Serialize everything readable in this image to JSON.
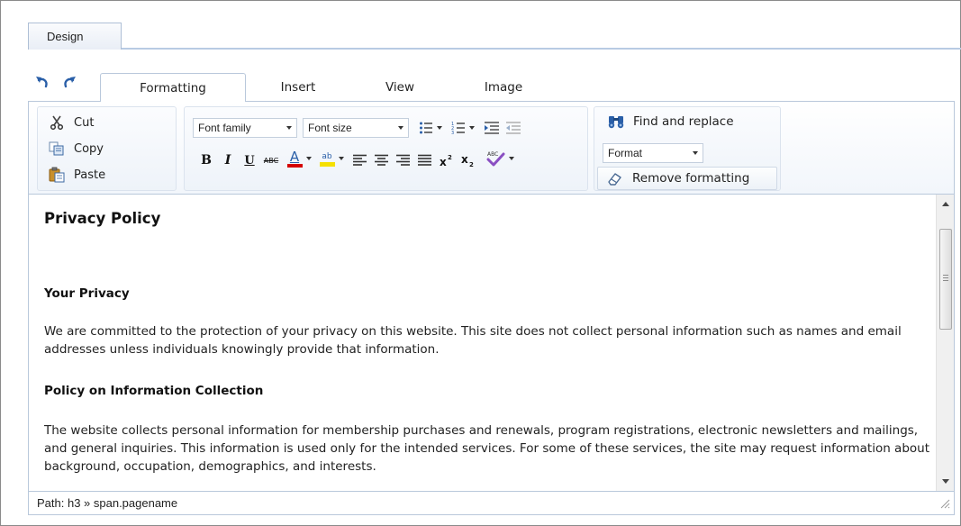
{
  "top_tabs": [
    {
      "label": "Design",
      "active": true
    }
  ],
  "ribbon_tabs": [
    {
      "label": "Formatting",
      "active": true
    },
    {
      "label": "Insert",
      "active": false
    },
    {
      "label": "View",
      "active": false
    },
    {
      "label": "Image",
      "active": false
    }
  ],
  "toolbar": {
    "undo_icon": "undo-icon",
    "redo_icon": "redo-icon",
    "clipboard": {
      "cut_label": "Cut",
      "copy_label": "Copy",
      "paste_label": "Paste"
    },
    "font": {
      "font_family_value": "Font family",
      "font_size_value": "Font size",
      "bold_label": "B",
      "italic_label": "I",
      "underline_label": "U",
      "strikethrough_label": "ABC",
      "font_color_label": "A",
      "highlight_label": "ab",
      "font_color_hex": "#d40000",
      "highlight_hex": "#f5e000"
    },
    "editing": {
      "find_replace_label": "Find and replace",
      "format_value": "Format",
      "remove_formatting_label": "Remove formatting"
    }
  },
  "document": {
    "title": "Privacy Policy",
    "sections": [
      {
        "heading": "Your Privacy",
        "body": "We are committed to the protection of your privacy on this website. This site does not collect personal information such as names and email addresses unless individuals knowingly provide that information."
      },
      {
        "heading": "Policy on Information Collection",
        "body": "The website collects personal information for membership purchases and renewals, program registrations, electronic newsletters and mailings, and general inquiries. This information is used only for the intended services. For some of these services, the site may request information about background, occupation, demographics, and interests."
      }
    ]
  },
  "status": {
    "path": "Path: h3 » span.pagename"
  },
  "colors": {
    "border": "#b9c8db",
    "tab_line": "#b8cbe3",
    "icon_blue": "#2a5fa8"
  }
}
